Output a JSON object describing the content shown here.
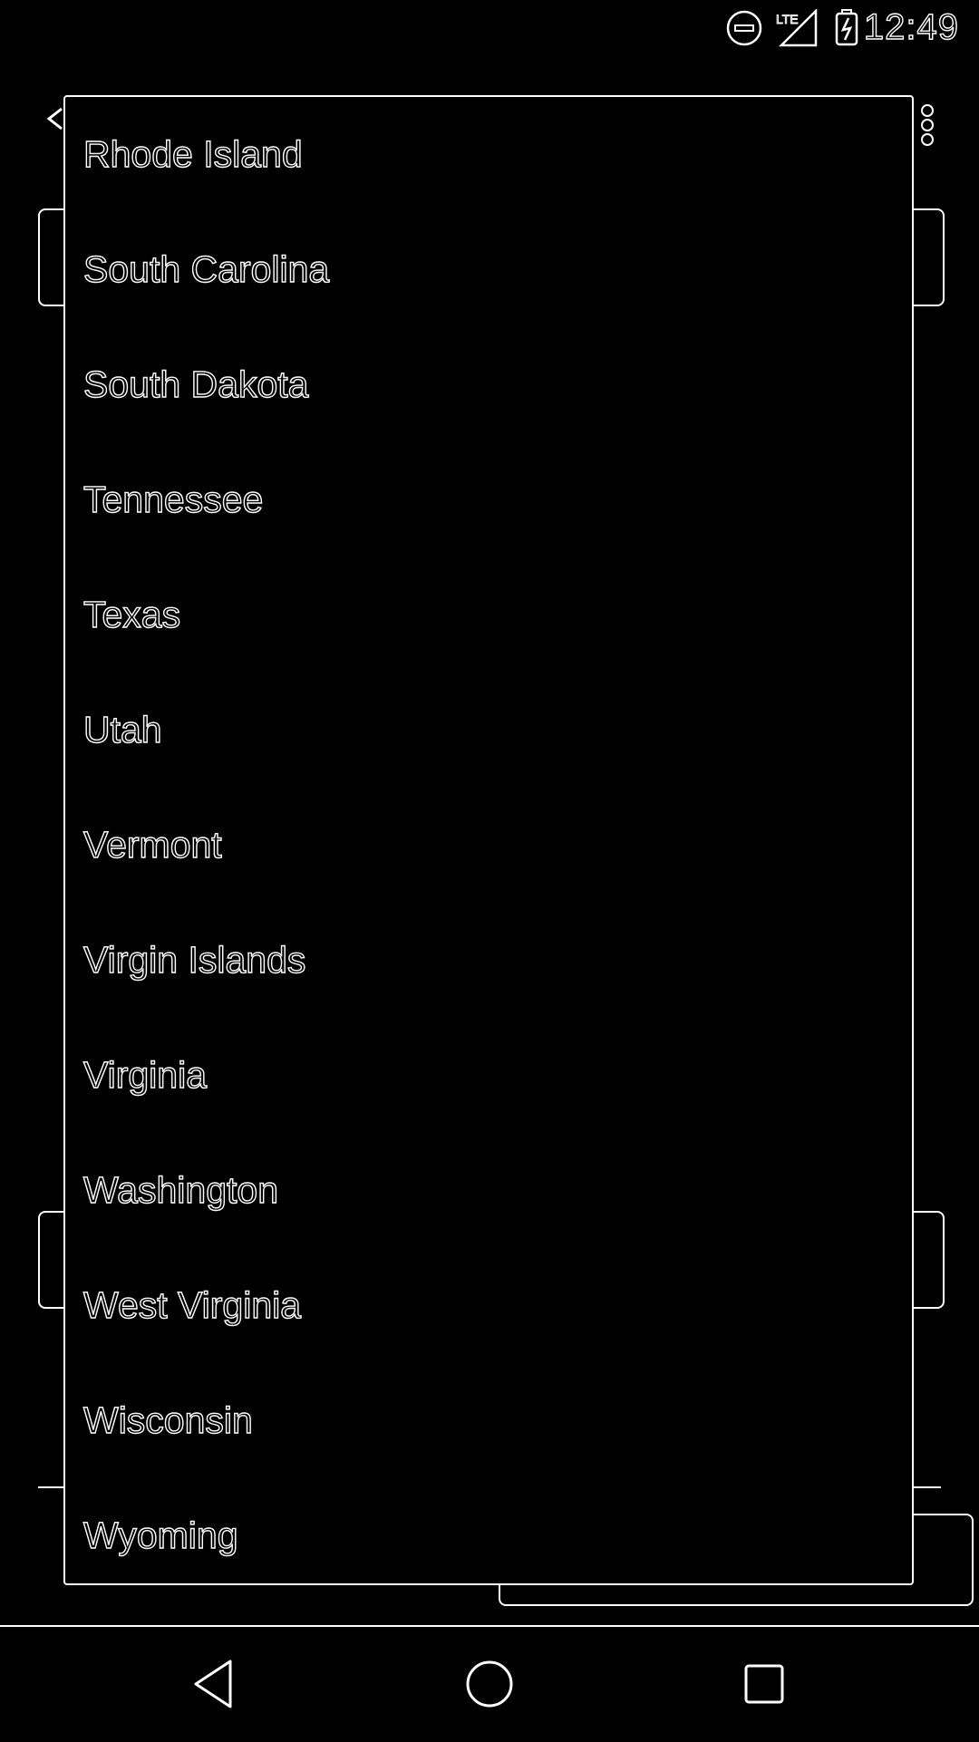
{
  "status_bar": {
    "time": "12:49",
    "network_label": "LTE",
    "icons": [
      "do-not-disturb-icon",
      "signal-icon",
      "battery-charging-icon"
    ]
  },
  "dropdown": {
    "options": [
      "Rhode Island",
      "South Carolina",
      "South Dakota",
      "Tennessee",
      "Texas",
      "Utah",
      "Vermont",
      "Virgin Islands",
      "Virginia",
      "Washington",
      "West Virginia",
      "Wisconsin",
      "Wyoming"
    ]
  },
  "nav_bar": {
    "icons": [
      "back-icon",
      "home-icon",
      "recents-icon"
    ]
  },
  "colors": {
    "background": "#000000",
    "outline": "#ffffff"
  }
}
